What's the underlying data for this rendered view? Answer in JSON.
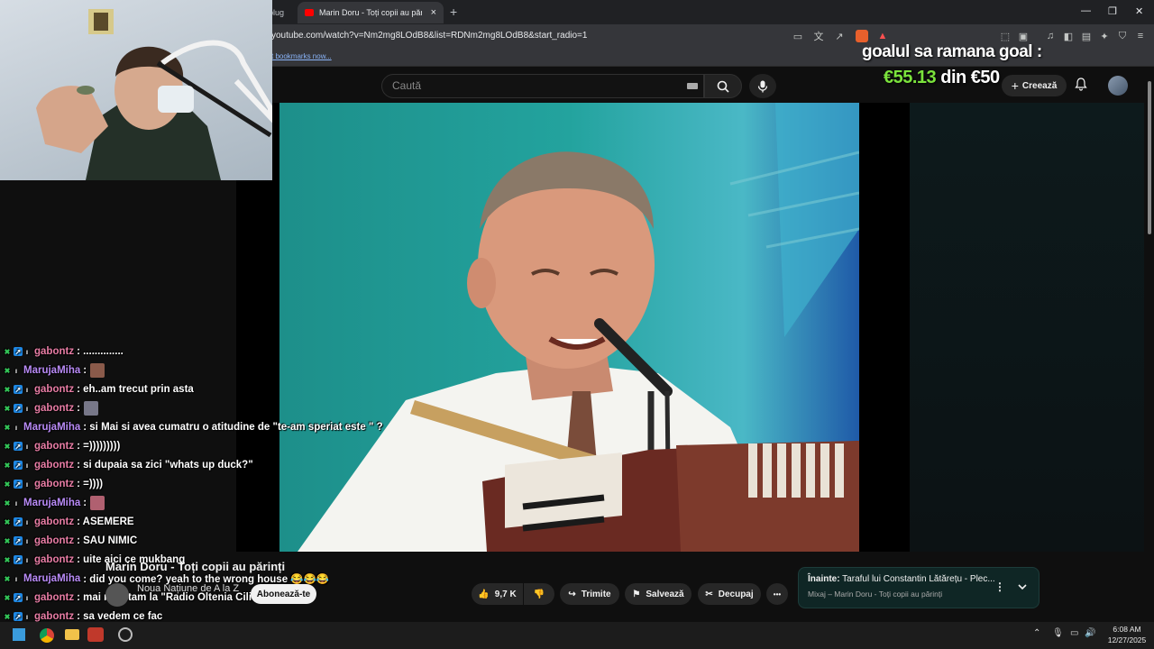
{
  "browser": {
    "tabs": [
      {
        "label": "blug"
      },
      {
        "label": "Marin Doru - Toți copii au părinți",
        "close": "×"
      }
    ],
    "new_tab": "+",
    "window": {
      "minimize": "—",
      "restore": "❐",
      "close": "✕"
    },
    "url": "youtube.com/watch?v=Nm2mg8LOdB8&list=RDNm2mg8LOdB8&start_radio=1",
    "bookmarks_link": "t bookmarks now..."
  },
  "youtube": {
    "search_placeholder": "Caută",
    "create_label": "Creează",
    "video": {
      "title": "Marin Doru - Toți copii au părinți",
      "channel": "Noua Națiune de A la Z",
      "subscribe_label": "Abonează-te",
      "likes": "9,7 K",
      "share_label": "Trimite",
      "save_label": "Salvează",
      "clip_label": "Decupaj",
      "more_label": "•••"
    },
    "mix": {
      "next_prefix": "Înainte:",
      "next_title": "Taraful lui Constantin Lătărețu - Plec...",
      "subtitle": "Mixaj – Marin Doru - Toți copii au părinți"
    }
  },
  "goal": {
    "title": "goalul sa ramana goal :",
    "current": "€55.13",
    "separator": "din",
    "target": "€50"
  },
  "chat": {
    "messages": [
      {
        "user": "gabontz",
        "text": ": ..............",
        "color": "#e87da5",
        "badges": [
          "mod",
          "vip",
          "sub"
        ]
      },
      {
        "user": "MarujaMiha",
        "text": ":",
        "color": "#b98bf7",
        "badges": [
          "mod",
          "sub"
        ],
        "emote": "#8a5a4a"
      },
      {
        "user": "gabontz",
        "text": ": eh..am trecut prin asta",
        "color": "#e87da5",
        "badges": [
          "mod",
          "vip",
          "sub"
        ]
      },
      {
        "user": "gabontz",
        "text": ":",
        "color": "#e87da5",
        "badges": [
          "mod",
          "vip",
          "sub"
        ],
        "emote": "#777788"
      },
      {
        "user": "MarujaMiha",
        "text": ": si Mai si avea cumatru o atitudine de \"te-am speriat este \" ?",
        "color": "#b98bf7",
        "badges": [
          "mod",
          "sub"
        ]
      },
      {
        "user": "gabontz",
        "text": ": =)))))))))",
        "color": "#e87da5",
        "badges": [
          "mod",
          "vip",
          "sub"
        ]
      },
      {
        "user": "gabontz",
        "text": ": si dupaia sa zici \"whats up duck?\"",
        "color": "#e87da5",
        "badges": [
          "mod",
          "vip",
          "sub"
        ]
      },
      {
        "user": "gabontz",
        "text": ": =))))",
        "color": "#e87da5",
        "badges": [
          "mod",
          "vip",
          "sub"
        ]
      },
      {
        "user": "MarujaMiha",
        "text": ":",
        "color": "#b98bf7",
        "badges": [
          "mod",
          "sub"
        ],
        "emote": "#b06070"
      },
      {
        "user": "gabontz",
        "text": ": ASEMERE",
        "color": "#e87da5",
        "badges": [
          "mod",
          "vip",
          "sub"
        ]
      },
      {
        "user": "gabontz",
        "text": ": SAU NIMIC",
        "color": "#e87da5",
        "badges": [
          "mod",
          "vip",
          "sub"
        ]
      },
      {
        "user": "gabontz",
        "text": ": uite aici ce mukbang",
        "color": "#e87da5",
        "badges": [
          "mod",
          "vip",
          "sub"
        ]
      },
      {
        "user": "MarujaMiha",
        "text": ": did you come? yeah to the wrong house 😂😂😂",
        "color": "#b98bf7",
        "badges": [
          "mod",
          "sub"
        ]
      },
      {
        "user": "gabontz",
        "text": ": mai ne uitam la \"Radio Oltenia Cilieni\"",
        "color": "#e87da5",
        "badges": [
          "mod",
          "vip",
          "sub"
        ]
      },
      {
        "user": "gabontz",
        "text": ": sa vedem ce fac",
        "color": "#e87da5",
        "badges": [
          "mod",
          "vip",
          "sub"
        ]
      },
      {
        "user": "gabontz",
        "text": ":",
        "color": "#e87da5",
        "badges": [
          "mod",
          "vip",
          "sub"
        ]
      }
    ]
  },
  "taskbar": {
    "time": "6:08 AM",
    "date": "12/27/2025"
  },
  "colors": {
    "goal_green": "#7be33c",
    "youtube_red": "#ff0000",
    "gabontz": "#e87da5",
    "maruja": "#b98bf7"
  }
}
